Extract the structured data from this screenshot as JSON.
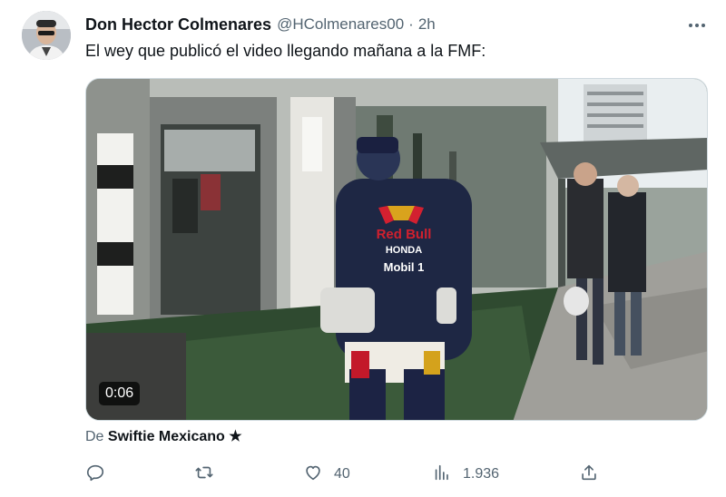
{
  "tweet": {
    "author_name": "Don Hector Colmenares",
    "author_handle": "@HColmenares00",
    "separator": "·",
    "time_ago": "2h",
    "text": "El wey que publicó el video llegando mañana a la FMF:"
  },
  "media": {
    "duration": "0:06",
    "jersey_lines": [
      "Red Bull",
      "HONDA",
      "Mobil 1"
    ]
  },
  "attribution": {
    "prefix": "De",
    "source": "Swiftie Mexicano ★"
  },
  "actions": {
    "reply_icon": "reply-icon",
    "retweet_icon": "retweet-icon",
    "like_icon": "heart-icon",
    "like_count": "40",
    "views_icon": "views-icon",
    "views_count": "1.936",
    "share_icon": "share-icon"
  },
  "colors": {
    "text_primary": "#0f1419",
    "text_secondary": "#536471",
    "border": "#cfd9de"
  }
}
